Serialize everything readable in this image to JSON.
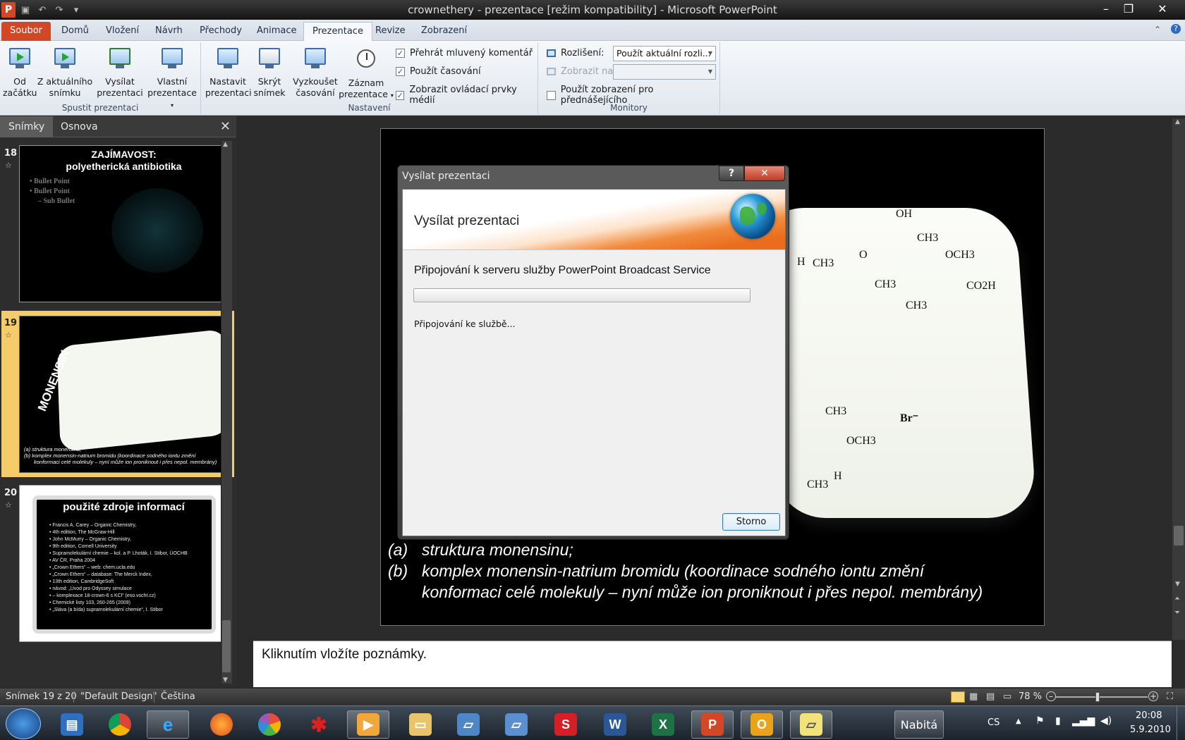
{
  "window": {
    "title": "crownethery - prezentace [režim kompatibility] - Microsoft PowerPoint",
    "app_icon": "P"
  },
  "ribbon_tabs": [
    "Soubor",
    "Domů",
    "Vložení",
    "Návrh",
    "Přechody",
    "Animace",
    "Prezentace",
    "Revize",
    "Zobrazení"
  ],
  "ribbon": {
    "start_group": {
      "label": "Spustit prezentaci",
      "buttons": [
        {
          "line1": "Od",
          "line2": "začátku"
        },
        {
          "line1": "Z aktuálního",
          "line2": "snímku"
        },
        {
          "line1": "Vysílat",
          "line2": "prezentaci"
        },
        {
          "line1": "Vlastní",
          "line2": "prezentace"
        }
      ]
    },
    "setup_group": {
      "label": "Nastavení",
      "buttons": [
        {
          "line1": "Nastavit",
          "line2": "prezentaci"
        },
        {
          "line1": "Skrýt",
          "line2": "snímek"
        },
        {
          "line1": "Vyzkoušet",
          "line2": "časování"
        },
        {
          "line1": "Záznam",
          "line2": "prezentace"
        }
      ],
      "checkboxes": [
        {
          "label": "Přehrát mluvený komentář",
          "checked": true
        },
        {
          "label": "Použít časování",
          "checked": true
        },
        {
          "label": "Zobrazit ovládací prvky médií",
          "checked": true
        }
      ]
    },
    "monitors_group": {
      "label": "Monitory",
      "resolution_label": "Rozlišení:",
      "resolution_value": "Použít aktuální rozli...",
      "show_on_label": "Zobrazit na:",
      "presenter_view_label": "Použít zobrazení pro přednášejícího",
      "presenter_view_checked": false
    }
  },
  "left_panel": {
    "tabs": [
      "Snímky",
      "Osnova"
    ],
    "slides": [
      {
        "number": "18",
        "title_line1": "ZAJÍMAVOST:",
        "title_line2": "polyetherická antibiotika",
        "bullets": [
          "• Bullet Point",
          "• Bullet Point",
          "– Sub Bullet"
        ]
      },
      {
        "number": "19",
        "vertical_title": "MONENSIN",
        "caption_a": "(a) struktura monensinu;",
        "caption_b": "(b) komplex monensin-natrium bromidu (koordinace sodného iontu změní",
        "caption_c": "konformaci celé molekuly – nyní může ion proniknout i přes nepol. membrány)"
      },
      {
        "number": "20",
        "title": "použité zdroje informací",
        "items": [
          "Francis A. Carey – Organic Chemistry,",
          "4th edition, The McGraw-Hill",
          "John McMurry – Organic Chemistry,",
          "9th edition, Cornell University",
          "Supramolekulární chemie – kol. a P. Lhoták, I. Stibor, ÚOCHB",
          "AV ČR, Praha 2004",
          "„Crown Ethers“ – web: chem.ucla.edu",
          "„Crown Ethers“ – database: The Merck Index,",
          "13th edition, CambridgeSoft",
          "návod: „Úvod pro Odyssey simulace",
          "– komplexace 18-crown-6 s KCl“ (eso.vscht.cz)",
          "Chemické listy 103, 260-265 (2009)",
          "„Sláva (a bída) supramolekulární chemie“, I. Stibor"
        ]
      }
    ]
  },
  "main_slide": {
    "chem_labels": {
      "oh": "OH",
      "h": "H",
      "ch3_a": "CH3",
      "ch3_b": "CH3",
      "o": "O",
      "och3_a": "OCH3",
      "ch3_c": "CH3",
      "co2h": "CO2H",
      "ch3_d": "CH3",
      "ch3_e": "CH3",
      "och3_b": "OCH3",
      "h2": "H",
      "ch3_f": "CH3",
      "br": "Br⁻"
    },
    "caption_a_label": "(a)",
    "caption_a": "struktura monensinu;",
    "caption_b_label": "(b)",
    "caption_b": "komplex monensin-natrium bromidu (koordinace sodného iontu změní",
    "caption_c": "konformaci celé molekuly – nyní může ion proniknout i přes nepol. membrány)"
  },
  "notes_placeholder": "Kliknutím vložíte poznámky.",
  "status_bar": {
    "slide": "Snímek 19 z 20",
    "theme": "\"Default Design\"",
    "language": "Čeština",
    "zoom": "78 %",
    "zoom_level": 0.45
  },
  "dialog": {
    "title": "Vysílat prezentaci",
    "help": "?",
    "close": "✕",
    "header_title": "Vysílat prezentaci",
    "message": "Připojování k serveru služby PowerPoint Broadcast Service",
    "status": "Připojování ke službě...",
    "cancel_label": "Storno",
    "progress": 0
  },
  "taskbar": {
    "battery_label": "Nabitá",
    "language": "CS",
    "time": "20:08",
    "date": "5.9.2010"
  }
}
